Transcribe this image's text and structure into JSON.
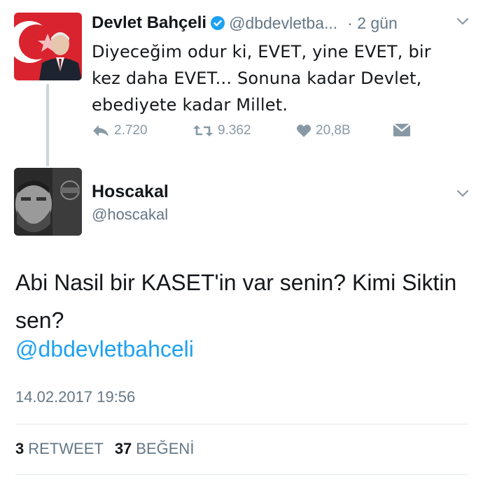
{
  "parent_tweet": {
    "name": "Devlet Bahçeli",
    "handle": "@dbdevletba...",
    "time": "· 2 gün",
    "text": "Diyeceğim odur ki, EVET, yine EVET, bir kez daha EVET... Sonuna kadar Devlet, ebediyete kadar Millet.",
    "actions": {
      "reply_count": "2.720",
      "retweet_count": "9.362",
      "like_count": "20,8B"
    }
  },
  "reply_tweet": {
    "name": "Hoscakal",
    "handle": "@hoscakal",
    "text": "Abi Nasil bir KASET'in var senin? Kimi Siktin sen?",
    "mention": "@dbdevletbahceli",
    "timestamp": "14.02.2017 19:56",
    "stats": {
      "retweets": "3",
      "retweets_label": "RETWEET",
      "likes": "37",
      "likes_label": "BEĞENİ"
    }
  },
  "colors": {
    "link": "#1da1f2",
    "muted": "#657786",
    "icon": "#8899a6",
    "verified": "#1da1f2"
  }
}
